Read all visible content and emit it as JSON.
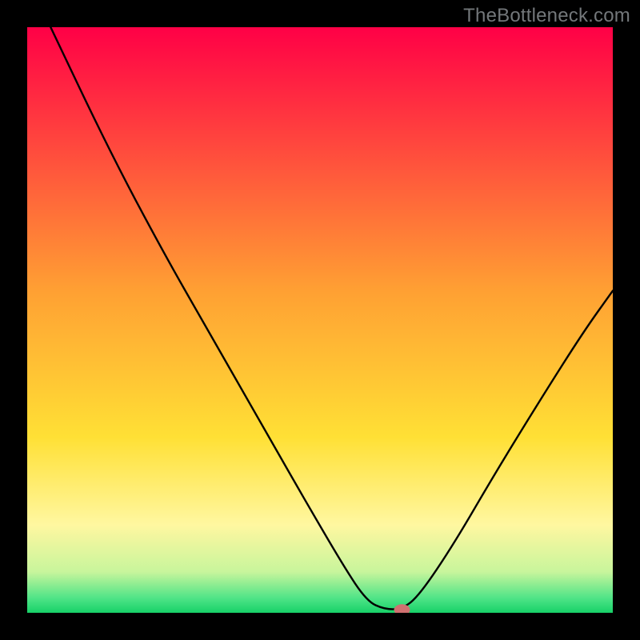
{
  "watermark": "TheBottleneck.com",
  "colors": {
    "gradient_stops": [
      {
        "offset": "0%",
        "color": "#ff0046"
      },
      {
        "offset": "45%",
        "color": "#ffa033"
      },
      {
        "offset": "70%",
        "color": "#ffe035"
      },
      {
        "offset": "85%",
        "color": "#fff7a0"
      },
      {
        "offset": "93%",
        "color": "#c8f59c"
      },
      {
        "offset": "97.5%",
        "color": "#4fe487"
      },
      {
        "offset": "100%",
        "color": "#17d168"
      }
    ],
    "curve": "#000000",
    "marker": "#d07070",
    "frame": "#000000"
  },
  "chart_data": {
    "type": "line",
    "title": "",
    "xlabel": "",
    "ylabel": "",
    "xlim": [
      0,
      100
    ],
    "ylim": [
      0,
      100
    ],
    "curve_points": [
      {
        "x": 4,
        "y": 100
      },
      {
        "x": 14,
        "y": 79
      },
      {
        "x": 23,
        "y": 62
      },
      {
        "x": 31,
        "y": 48
      },
      {
        "x": 39,
        "y": 34
      },
      {
        "x": 47,
        "y": 20
      },
      {
        "x": 54,
        "y": 8
      },
      {
        "x": 58,
        "y": 2
      },
      {
        "x": 61,
        "y": 0.6
      },
      {
        "x": 64,
        "y": 0.6
      },
      {
        "x": 67,
        "y": 3
      },
      {
        "x": 73,
        "y": 12
      },
      {
        "x": 80,
        "y": 24
      },
      {
        "x": 88,
        "y": 37
      },
      {
        "x": 95,
        "y": 48
      },
      {
        "x": 100,
        "y": 55
      }
    ],
    "marker": {
      "x": 64,
      "y": 0.5
    },
    "annotations": []
  }
}
